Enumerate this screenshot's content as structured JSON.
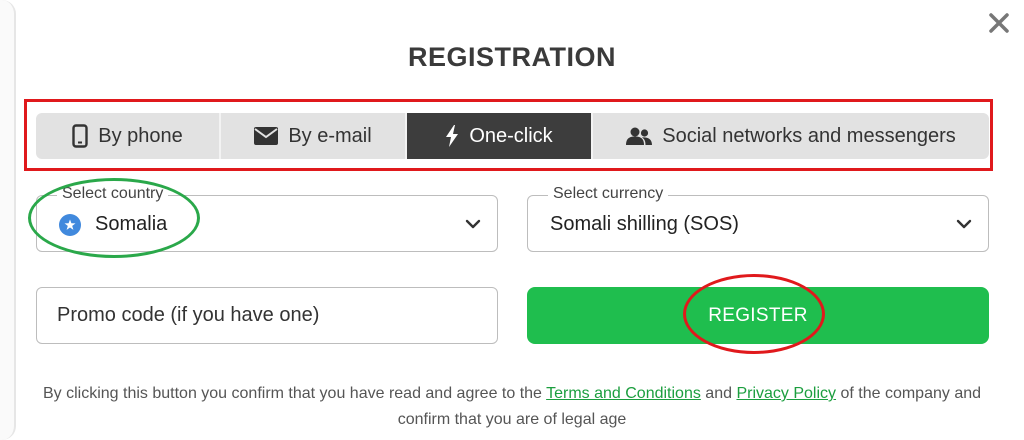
{
  "title": "REGISTRATION",
  "close_icon": "close-icon",
  "tabs": [
    {
      "label": "By phone",
      "icon": "phone-icon",
      "active": false
    },
    {
      "label": "By e-mail",
      "icon": "envelope-icon",
      "active": false
    },
    {
      "label": "One-click",
      "icon": "lightning-icon",
      "active": true
    },
    {
      "label": "Social networks and messengers",
      "icon": "users-icon",
      "active": false
    }
  ],
  "country": {
    "label": "Select country",
    "value": "Somalia",
    "flag_icon": "somalia-flag-icon"
  },
  "currency": {
    "label": "Select currency",
    "value": "Somali shilling (SOS)"
  },
  "promo": {
    "placeholder": "Promo code (if you have one)",
    "value": ""
  },
  "register_label": "REGISTER",
  "disclaimer": {
    "before_terms": "By clicking this button you confirm that you have read and agree to the ",
    "terms_link": "Terms and Conditions",
    "and": " and ",
    "privacy_link": "Privacy Policy",
    "after": " of the company and confirm that you are of legal age"
  },
  "colors": {
    "accent_green": "#1fbe4e",
    "link_green": "#1b9e3e",
    "active_tab": "#3d3d3d",
    "annotation_red": "#e0191c",
    "annotation_green": "#2aa84a"
  }
}
